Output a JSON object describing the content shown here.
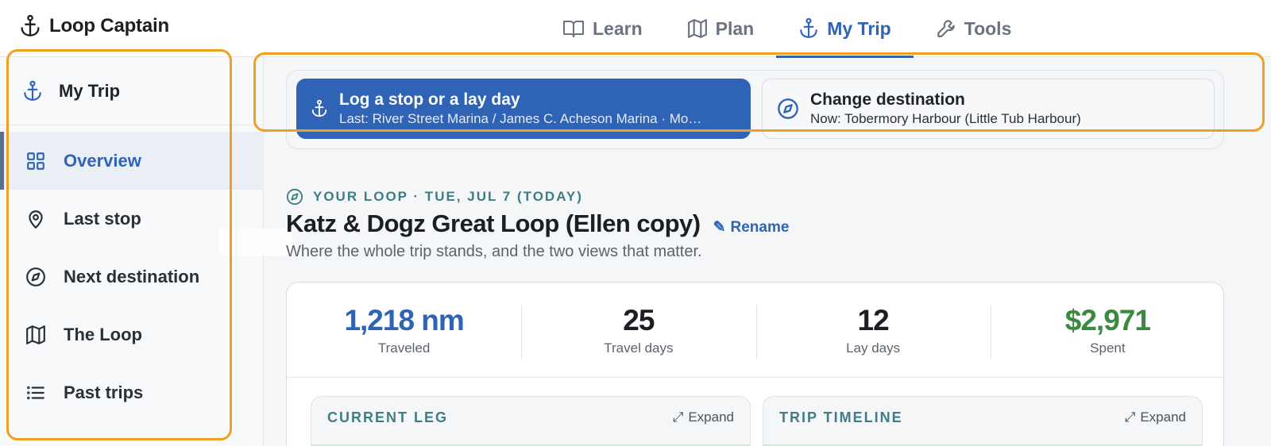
{
  "app": {
    "name": "Loop Captain"
  },
  "nav": {
    "items": [
      {
        "label": "Learn",
        "icon": "book-icon"
      },
      {
        "label": "Plan",
        "icon": "map-icon"
      },
      {
        "label": "My Trip",
        "icon": "anchor-icon",
        "active": true
      },
      {
        "label": "Tools",
        "icon": "wrench-icon"
      }
    ]
  },
  "sidebar": {
    "header": "My Trip",
    "items": [
      {
        "label": "Overview",
        "icon": "grid-icon",
        "active": true
      },
      {
        "label": "Last stop",
        "icon": "map-pin-icon"
      },
      {
        "label": "Next destination",
        "icon": "compass-icon"
      },
      {
        "label": "The Loop",
        "icon": "map-icon"
      },
      {
        "label": "Past trips",
        "icon": "list-icon"
      }
    ]
  },
  "actions": {
    "log": {
      "title": "Log a stop or a lay day",
      "subtitle": "Last: River Street Marina / James C. Acheson Marina · Mo…"
    },
    "change": {
      "title": "Change destination",
      "subtitle": "Now: Tobermory Harbour (Little Tub Harbour)"
    }
  },
  "overview": {
    "eyebrow": "YOUR LOOP · TUE, JUL 7 (TODAY)",
    "title": "Katz & Dogz Great Loop (Ellen copy)",
    "rename": "Rename",
    "subtitle": "Where the whole trip stands, and the two views that matter."
  },
  "stats": [
    {
      "value": "1,218 nm",
      "label": "Traveled",
      "color": "#2e63b6"
    },
    {
      "value": "25",
      "label": "Travel days",
      "color": "#1b1f24"
    },
    {
      "value": "12",
      "label": "Lay days",
      "color": "#1b1f24"
    },
    {
      "value": "$2,971",
      "label": "Spent",
      "color": "#3a8a3f"
    }
  ],
  "panels": {
    "current_leg": {
      "title": "CURRENT LEG",
      "expand": "Expand"
    },
    "timeline": {
      "title": "TRIP TIMELINE",
      "expand": "Expand"
    }
  },
  "colors": {
    "accent": "#2e63b6",
    "teal": "#3f7d86",
    "highlight": "#f0a020",
    "money": "#3a8a3f"
  }
}
